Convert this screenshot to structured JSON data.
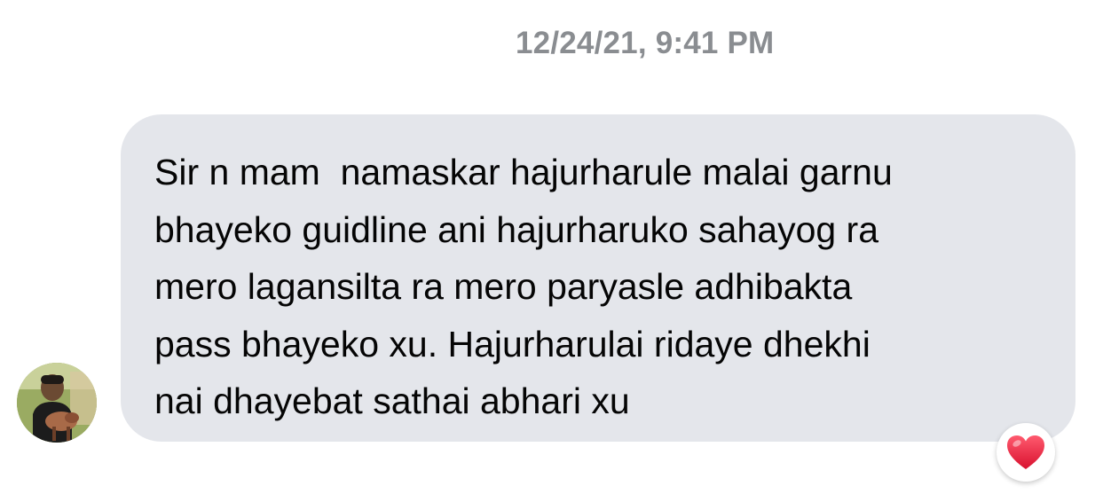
{
  "conversation": {
    "timestamp": "12/24/21, 9:41 PM",
    "message": {
      "text": "Sir n mam  namaskar hajurharule malai garnu\nbhayeko guidline ani hajurharuko sahayog ra\nmero lagansilta ra mero paryasle adhibakta\npass bhayeko xu. Hajurharulai ridaye dhekhi\nnai dhayebat sathai abhari xu",
      "reaction": "heart-icon"
    },
    "sender": {
      "avatar": "avatar-photo"
    }
  },
  "colors": {
    "bubble": "#e4e6eb",
    "timestamp": "#8a8d91",
    "text": "#050505",
    "heart": "#e0245e"
  }
}
